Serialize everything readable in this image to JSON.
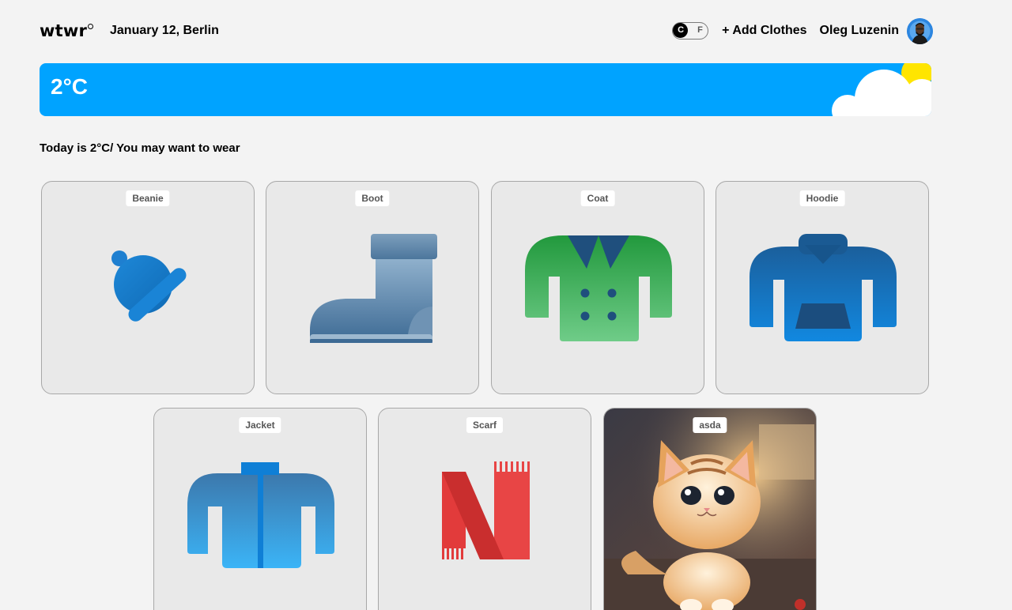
{
  "header": {
    "logo": "wtwr",
    "date_location": "January 12, Berlin",
    "unit_toggle": {
      "c_label": "C",
      "f_label": "F",
      "selected": "C"
    },
    "add_clothes_label": "+ Add Clothes",
    "username": "Oleg Luzenin"
  },
  "weather": {
    "temperature": "2°C",
    "icon": "sun-cloud-icon"
  },
  "subtitle": "Today is 2°C/ You may want to wear",
  "cards": [
    {
      "label": "Beanie",
      "icon": "beanie-icon"
    },
    {
      "label": "Boot",
      "icon": "boot-icon"
    },
    {
      "label": "Coat",
      "icon": "coat-icon"
    },
    {
      "label": "Hoodie",
      "icon": "hoodie-icon"
    },
    {
      "label": "Jacket",
      "icon": "jacket-icon"
    },
    {
      "label": "Scarf",
      "icon": "scarf-icon"
    },
    {
      "label": "asda",
      "icon": "kitten-image"
    }
  ],
  "colors": {
    "banner": "#00a3ff",
    "background": "#f3f3f3",
    "card": "#e9e9e9"
  }
}
